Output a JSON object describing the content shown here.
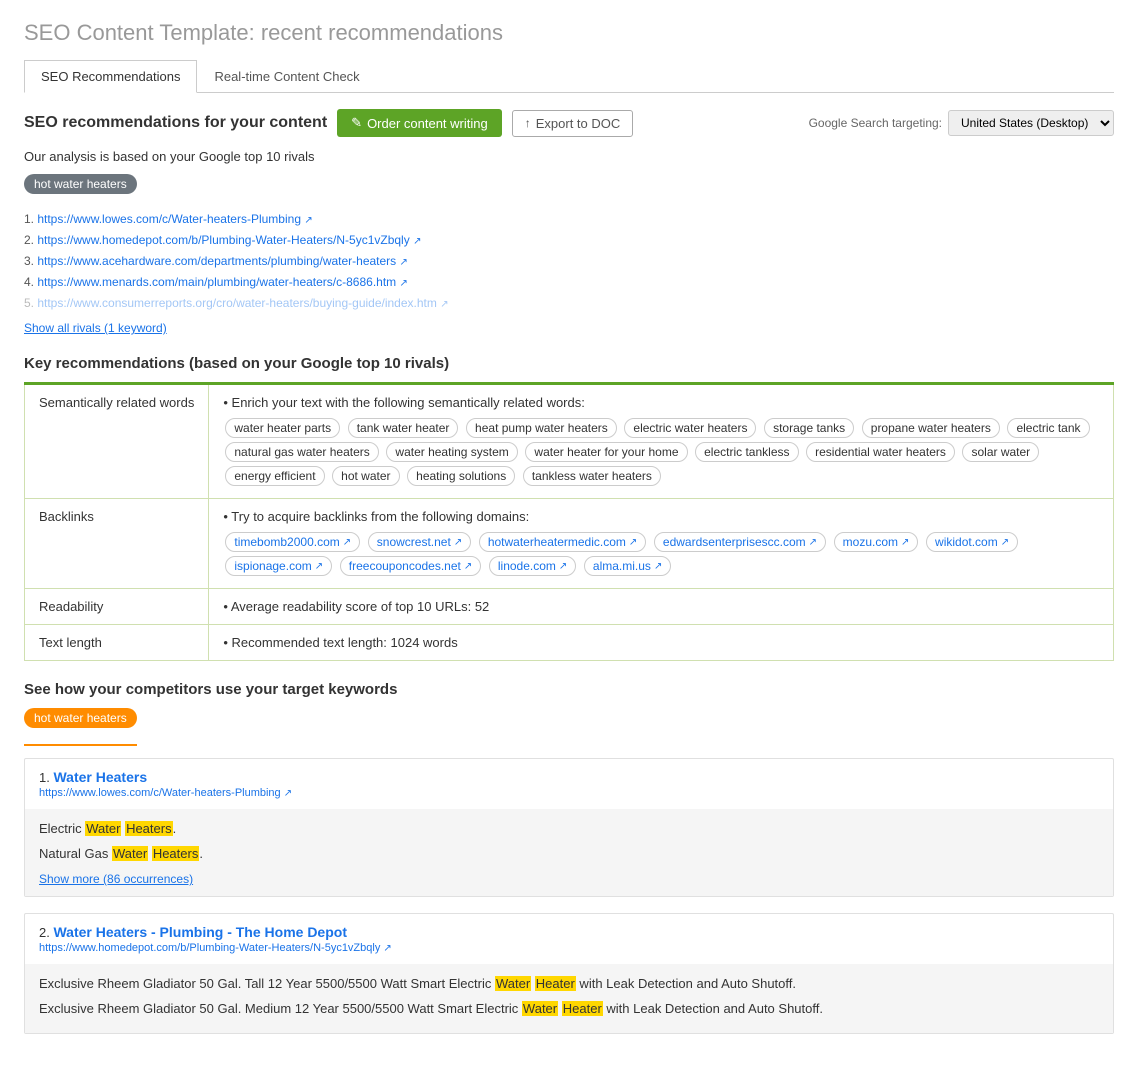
{
  "page": {
    "title_static": "SEO Content Template:",
    "title_dynamic": "recent recommendations"
  },
  "tabs": [
    {
      "id": "seo-rec",
      "label": "SEO Recommendations",
      "active": true
    },
    {
      "id": "realtime",
      "label": "Real-time Content Check",
      "active": false
    }
  ],
  "toolbar": {
    "section_title": "SEO recommendations for your content",
    "order_button": "Order content writing",
    "export_button": "Export to DOC",
    "targeting_label": "Google Search targeting:",
    "targeting_value": "United States (Desktop) ↓"
  },
  "analysis": {
    "note": "Our analysis is based on your Google top 10 rivals",
    "keyword": "hot water heaters",
    "rivals": [
      {
        "num": "1.",
        "url": "https://www.lowes.com/c/Water-heaters-Plumbing",
        "faded": false
      },
      {
        "num": "2.",
        "url": "https://www.homedepot.com/b/Plumbing-Water-Heaters/N-5yc1vZbqly",
        "faded": false
      },
      {
        "num": "3.",
        "url": "https://www.acehardware.com/departments/plumbing/water-heaters",
        "faded": false
      },
      {
        "num": "4.",
        "url": "https://www.menards.com/main/plumbing/water-heaters/c-8686.htm",
        "faded": false
      },
      {
        "num": "5.",
        "url": "https://www.consumerreports.org/cro/water-heaters/buying-guide/index.htm",
        "faded": true
      }
    ],
    "show_all_link": "Show all rivals (1 keyword)"
  },
  "recommendations": {
    "title": "Key recommendations (based on your Google top 10 rivals)",
    "rows": [
      {
        "label": "Semantically related words",
        "intro": "Enrich your text with the following semantically related words:",
        "words": [
          "water heater parts",
          "tank water heater",
          "heat pump water heaters",
          "electric water heaters",
          "storage tanks",
          "propane water heaters",
          "electric tank",
          "natural gas water heaters",
          "water heating system",
          "water heater for your home",
          "electric tankless",
          "residential water heaters",
          "solar water",
          "energy efficient",
          "hot water",
          "heating solutions",
          "tankless water heaters"
        ]
      },
      {
        "label": "Backlinks",
        "intro": "Try to acquire backlinks from the following domains:",
        "links": [
          "timebomb2000.com",
          "snowcrest.net",
          "hotwaterheatermedic.com",
          "edwardsenterprisescc.com",
          "mozu.com",
          "wikidot.com",
          "ispionage.com",
          "freecouponcodes.net",
          "linode.com",
          "alma.mi.us"
        ]
      },
      {
        "label": "Readability",
        "text": "Average readability score of top 10 URLs: 52"
      },
      {
        "label": "Text length",
        "text": "Recommended text length: 1024 words"
      }
    ]
  },
  "competitors_section": {
    "title": "See how your competitors use your target keywords",
    "keyword": "hot water heaters",
    "items": [
      {
        "num": "1.",
        "title": "Water Heaters",
        "url": "https://www.lowes.com/c/Water-heaters-Plumbing",
        "snippets": [
          {
            "text": "Electric Water Heaters.",
            "highlights": [
              "Water",
              "Heaters"
            ]
          },
          {
            "text": "Natural Gas Water Heaters.",
            "highlights": [
              "Water",
              "Heaters"
            ]
          }
        ],
        "show_more": "Show more (86 occurrences)"
      },
      {
        "num": "2.",
        "title": "Water Heaters - Plumbing - The Home Depot",
        "url": "https://www.homedepot.com/b/Plumbing-Water-Heaters/N-5yc1vZbqly",
        "snippets": [
          {
            "text": "Exclusive Rheem Gladiator 50 Gal. Tall 12 Year 5500/5500 Watt Smart Electric Water Heater with Leak Detection and Auto Shutoff.",
            "highlights": [
              "Water",
              "Heater"
            ]
          },
          {
            "text": "Exclusive Rheem Gladiator 50 Gal. Medium 12 Year 5500/5500 Watt Smart Electric Water Heater with Leak Detection and Auto Shutoff.",
            "highlights": [
              "Water",
              "Heater"
            ]
          }
        ],
        "show_more": null
      }
    ]
  },
  "icons": {
    "external_link": "↗",
    "upload": "↑",
    "edit": "✎",
    "dropdown": "▾"
  }
}
